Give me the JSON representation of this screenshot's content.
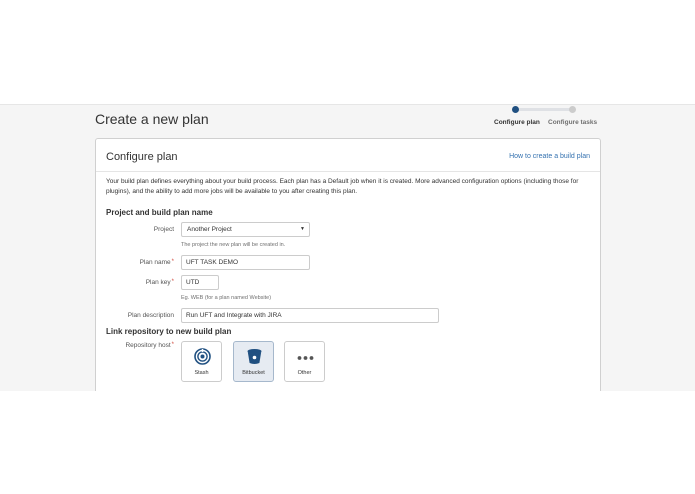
{
  "header": {
    "page_title": "Create a new plan"
  },
  "progress": {
    "steps": [
      {
        "label": "Configure plan",
        "state": "active"
      },
      {
        "label": "Configure tasks",
        "state": "inactive"
      }
    ]
  },
  "card": {
    "title": "Configure plan",
    "help_link": "How to create a build plan",
    "intro": "Your build plan defines everything about your build process. Each plan has a Default job when it is created. More advanced configuration options (including those for plugins), and the ability to add more jobs will be available to you after creating this plan."
  },
  "section_project": {
    "heading": "Project and build plan name",
    "project": {
      "label": "Project",
      "value": "Another Project",
      "hint": "The project the new plan will be created in."
    },
    "plan_name": {
      "label": "Plan name",
      "required_mark": "*",
      "value": "UFT TASK DEMO"
    },
    "plan_key": {
      "label": "Plan key",
      "required_mark": "*",
      "value": "UTD",
      "hint": "Eg. WEB (for a plan named Website)"
    },
    "plan_description": {
      "label": "Plan description",
      "value": "Run UFT and Integrate with JIRA"
    }
  },
  "section_repo": {
    "heading": "Link repository to new build plan",
    "host_label": "Repository host",
    "required_mark": "*",
    "hosts": [
      {
        "label": "Stash",
        "icon": "stash-icon",
        "selected": false
      },
      {
        "label": "Bitbucket",
        "icon": "bitbucket-icon",
        "selected": true
      },
      {
        "label": "Other",
        "icon": "more-dots-icon",
        "selected": false
      }
    ]
  },
  "colors": {
    "accent": "#205081",
    "link": "#3572b0",
    "required": "#d04437",
    "band_bg": "#f5f5f5"
  }
}
